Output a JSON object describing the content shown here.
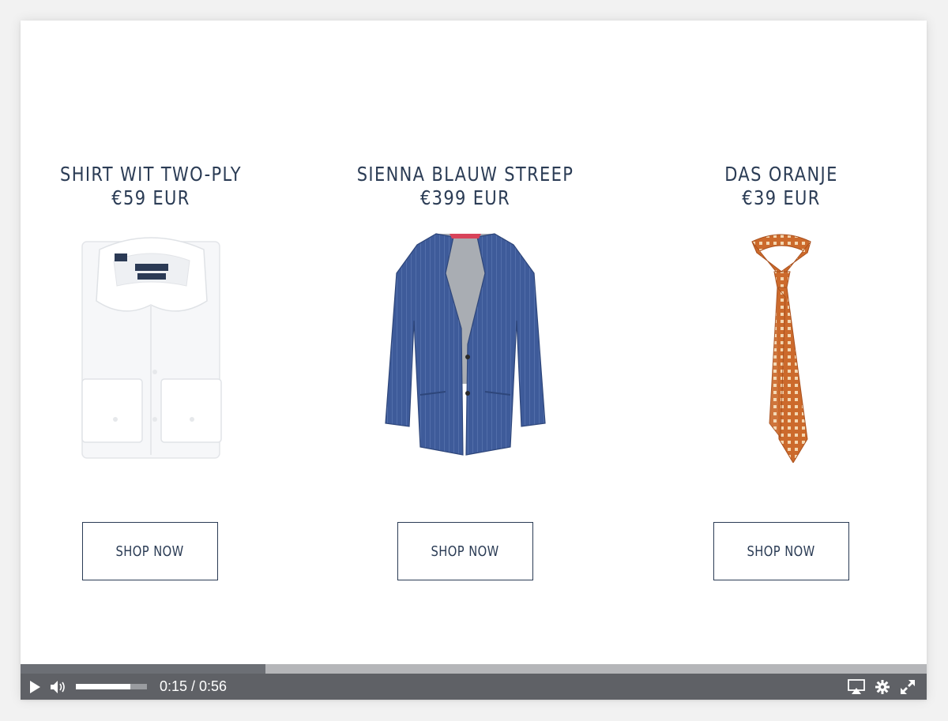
{
  "products": [
    {
      "title": "SHIRT WIT TWO-PLY",
      "price": "€59 EUR",
      "button_label": "SHOP NOW",
      "image": "white-shirt"
    },
    {
      "title": "SIENNA BLAUW STREEP",
      "price": "€399 EUR",
      "button_label": "SHOP NOW",
      "image": "blue-pinstripe-jacket"
    },
    {
      "title": "DAS ORANJE",
      "price": "€39 EUR",
      "button_label": "SHOP NOW",
      "image": "orange-tie"
    }
  ],
  "player": {
    "current_time": "0:15",
    "duration": "0:56",
    "time_display": "0:15 / 0:56",
    "progress_fraction": 0.27,
    "volume_fraction": 0.77,
    "icons": [
      "play-icon",
      "volume-icon",
      "airplay-icon",
      "settings-icon",
      "fullscreen-icon"
    ]
  },
  "colors": {
    "text": "#2b3c55",
    "controls_bg": "#5f6166",
    "progress_track": "#b5b6b9",
    "progress_played": "#6c6f75"
  }
}
